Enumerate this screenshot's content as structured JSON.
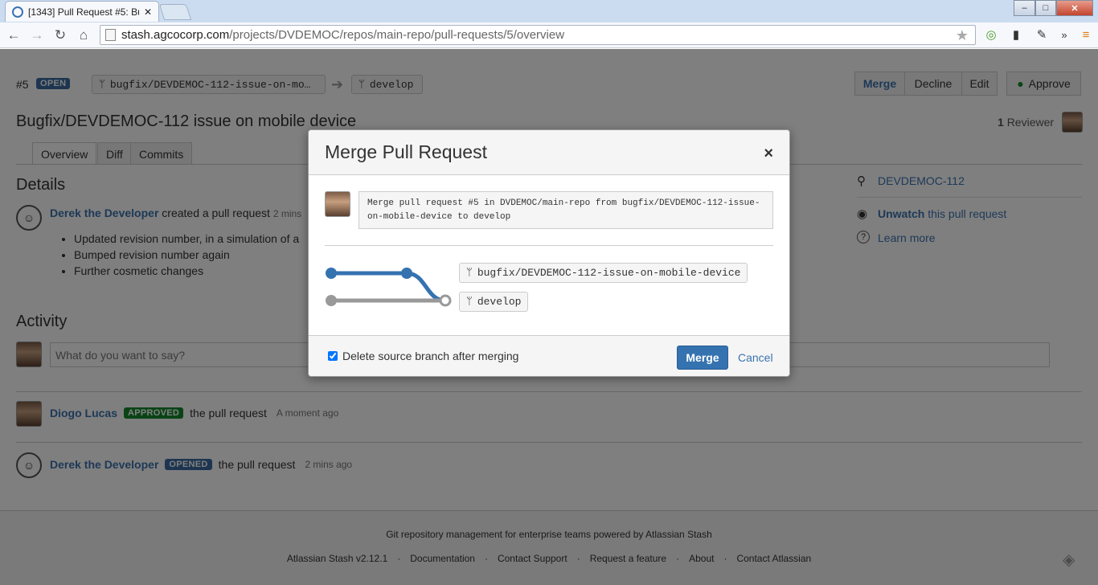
{
  "browser": {
    "tab_title": "[1343] Pull Request #5: Bu",
    "url_domain": "stash.agcocorp.com",
    "url_path": "/projects/DVDEMOC/repos/main-repo/pull-requests/5/overview",
    "win_min": "–",
    "win_max": "□",
    "win_close": "✕",
    "overflow": "»"
  },
  "pr": {
    "number": "#5",
    "state": "OPEN",
    "source_branch": "bugfix/DEVDEMOC-112-issue-on-mo…",
    "target_branch": "develop",
    "title": "Bugfix/DEVDEMOC-112 issue on mobile device",
    "reviewers_count": "1",
    "reviewers_label": "Reviewer"
  },
  "actions": {
    "merge": "Merge",
    "decline": "Decline",
    "edit": "Edit",
    "approve": "Approve"
  },
  "tabs": [
    "Overview",
    "Diff",
    "Commits"
  ],
  "details": {
    "heading": "Details",
    "author": "Derek the Developer",
    "action": "created a pull request",
    "time": "2 mins",
    "bullets": [
      "Updated revision number, in a simulation of a",
      "Bumped revision number again",
      "Further cosmetic changes"
    ]
  },
  "sidebar": {
    "issue": "DEVDEMOC-112",
    "watch": "Unwatch",
    "watch_rest": " this pull request",
    "learn": "Learn more"
  },
  "activity": {
    "heading": "Activity",
    "placeholder": "What do you want to say?",
    "items": [
      {
        "user": "Diogo Lucas",
        "badge": "APPROVED",
        "text": "the pull request",
        "time": "A moment ago"
      },
      {
        "user": "Derek the Developer",
        "badge": "OPENED",
        "text": "the pull request",
        "time": "2 mins ago"
      }
    ]
  },
  "footer": {
    "tagline": "Git repository management for enterprise teams powered by Atlassian Stash",
    "links": [
      "Atlassian Stash v2.12.1",
      "Documentation",
      "Contact Support",
      "Request a feature",
      "About",
      "Contact Atlassian"
    ]
  },
  "dialog": {
    "title": "Merge Pull Request",
    "close": "×",
    "commit_message": "Merge pull request #5 in DVDEMOC/main-repo from bugfix/DEVDEMOC-112-issue-on-mobile-device to develop",
    "source_branch": "bugfix/DEVDEMOC-112-issue-on-mobile-device",
    "target_branch": "develop",
    "delete_label": "Delete source branch after merging",
    "delete_checked": true,
    "merge": "Merge",
    "cancel": "Cancel"
  },
  "colors": {
    "accent": "#3b73af",
    "open": "#3b6aa0",
    "approved": "#14892c",
    "opened": "#3b6aa0",
    "merge_btn": "#3572b0"
  }
}
